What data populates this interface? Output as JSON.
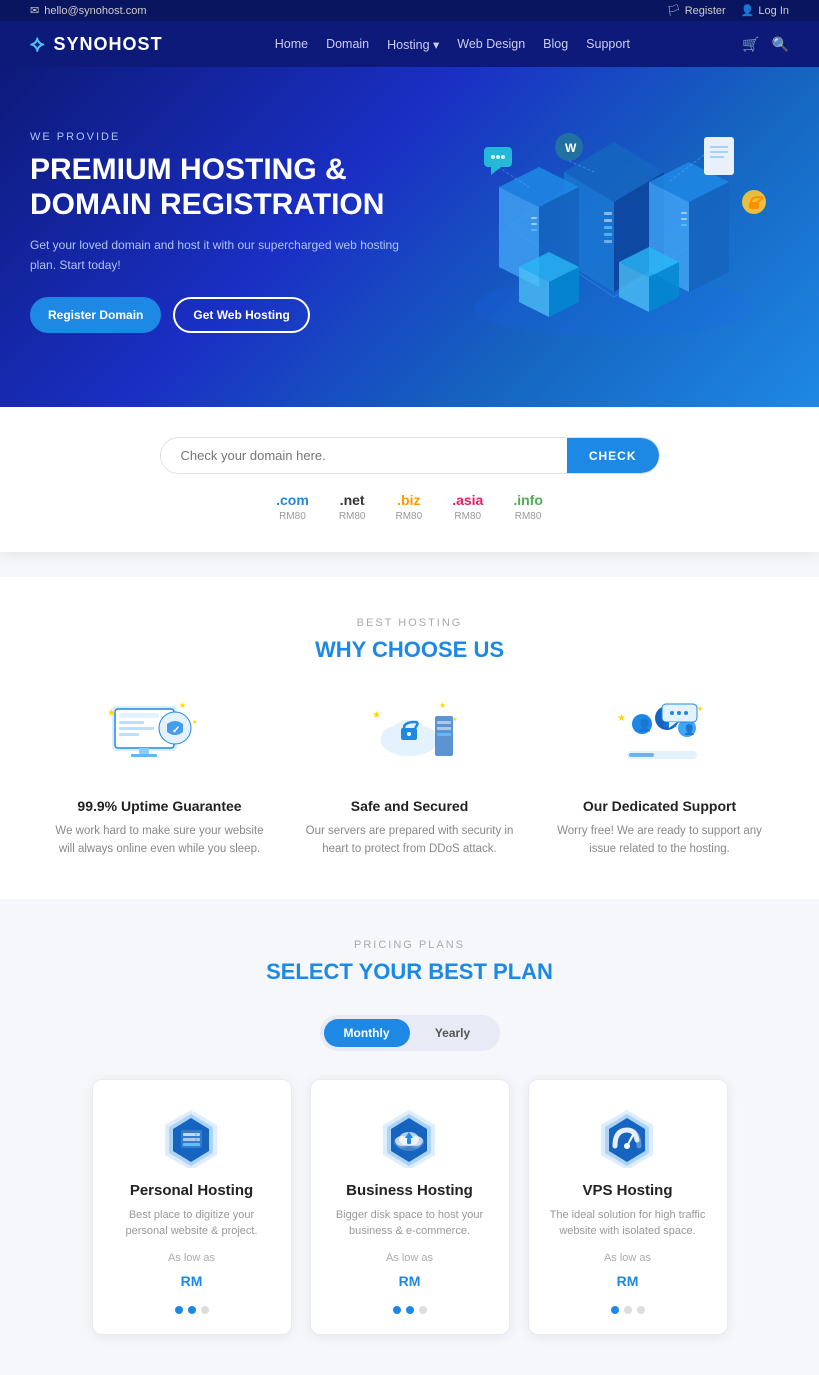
{
  "topbar": {
    "email": "hello@synohost.com",
    "register_label": "Register",
    "login_label": "Log In"
  },
  "header": {
    "logo_text": "SYNOHOST",
    "nav_items": [
      {
        "label": "Home"
      },
      {
        "label": "Domain"
      },
      {
        "label": "Hosting"
      },
      {
        "label": "Web Design"
      },
      {
        "label": "Blog"
      },
      {
        "label": "Support"
      }
    ]
  },
  "hero": {
    "subtitle": "WE PROVIDE",
    "title_line1": "PREMIUM HOSTING &",
    "title_line2": "DOMAIN REGISTRATION",
    "description": "Get your loved domain and host it with our supercharged web hosting plan. Start today!",
    "btn_register": "Register Domain",
    "btn_hosting": "Get Web Hosting"
  },
  "domain": {
    "placeholder": "Check your domain here.",
    "btn_label": "CHECK",
    "tlds": [
      {
        "name": ".com",
        "price": "RM80",
        "color": "tld-com"
      },
      {
        "name": ".net",
        "price": "RM80",
        "color": "tld-net"
      },
      {
        "name": ".biz",
        "price": "RM80",
        "color": "tld-biz"
      },
      {
        "name": ".asia",
        "price": "RM80",
        "color": "tld-asia"
      },
      {
        "name": ".info",
        "price": "RM80",
        "color": "tld-info"
      }
    ]
  },
  "why": {
    "tag": "Best Hosting",
    "title_part1": "WHY ",
    "title_highlight": "CHOOSE US",
    "features": [
      {
        "title": "99.9% Uptime Guarantee",
        "desc": "We work hard to make sure your website will always online even while you sleep."
      },
      {
        "title": "Safe and Secured",
        "desc": "Our servers are prepared with security in heart to protect from DDoS attack."
      },
      {
        "title": "Our Dedicated Support",
        "desc": "Worry free! We are ready to support any issue related to the hosting."
      }
    ]
  },
  "pricing": {
    "tag": "Pricing Plans",
    "title_part1": "SELECT YOUR ",
    "title_highlight": "BEST PLAN",
    "toggle_monthly": "Monthly",
    "toggle_yearly": "Yearly",
    "plans": [
      {
        "name": "Personal Hosting",
        "desc": "Best place to digitize your personal website & project.",
        "as_low_as": "As low as",
        "price": "RM",
        "dots": [
          true,
          true,
          false
        ]
      },
      {
        "name": "Business Hosting",
        "desc": "Bigger disk space to host your business & e-commerce.",
        "as_low_as": "As low as",
        "price": "RM",
        "dots": [
          true,
          true,
          false
        ]
      },
      {
        "name": "VPS Hosting",
        "desc": "The ideal solution for high traffic website with isolated space.",
        "as_low_as": "As low as",
        "price": "RM",
        "dots": [
          true,
          false,
          false
        ]
      }
    ]
  }
}
